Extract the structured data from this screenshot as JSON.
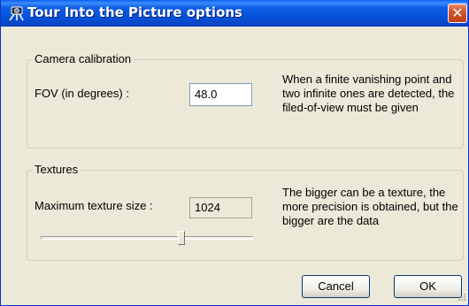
{
  "window": {
    "title": "Tour Into the Picture options",
    "close_glyph": "✕"
  },
  "camera": {
    "legend": "Camera calibration",
    "fov_label": "FOV (in degrees) :",
    "fov_value": "48.0",
    "description": "When a finite vanishing point and two infinite ones are detected, the filed-of-view must be given"
  },
  "textures": {
    "legend": "Textures",
    "size_label": "Maximum texture size :",
    "size_value": "1024",
    "slider_fraction": 0.67,
    "description": "The bigger can be a texture, the more precision is obtained, but the bigger are the data"
  },
  "buttons": {
    "cancel": "Cancel",
    "ok": "OK"
  },
  "colors": {
    "titlebar": "#0551d8",
    "dialog_bg": "#ece9d8",
    "close": "#d1532d"
  }
}
